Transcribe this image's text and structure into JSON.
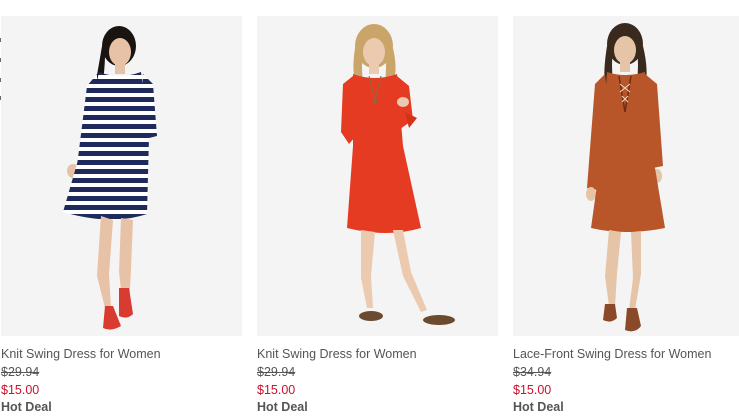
{
  "products": [
    {
      "name": "Knit Swing Dress for Women",
      "original_price": "$29.94",
      "sale_price": "$15.00",
      "badge": "Hot Deal",
      "dress_color": "#1e2a5c",
      "dress_pattern": "navy and white stripes",
      "shoe_color": "#d93b30"
    },
    {
      "name": "Knit Swing Dress for Women",
      "original_price": "$29.94",
      "sale_price": "$15.00",
      "badge": "Hot Deal",
      "dress_color": "#e63b23",
      "dress_pattern": "solid",
      "shoe_color": "#6b4a2e"
    },
    {
      "name": "Lace-Front Swing Dress for Women",
      "original_price": "$34.94",
      "sale_price": "$15.00",
      "badge": "Hot Deal",
      "dress_color": "#b8562a",
      "dress_pattern": "solid",
      "shoe_color": "#8a4a2a"
    }
  ],
  "colors": {
    "sale_price": "#c8102e",
    "text": "#555555",
    "photo_background": "#f4f4f4"
  }
}
